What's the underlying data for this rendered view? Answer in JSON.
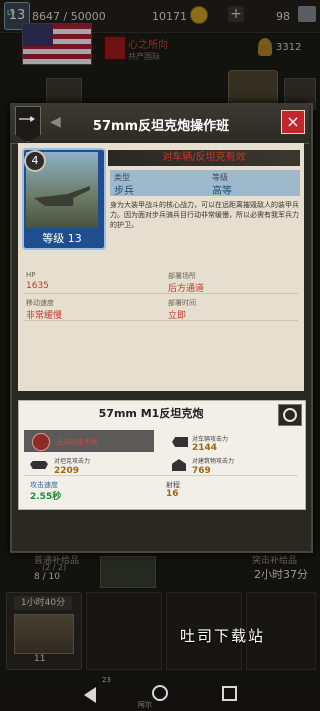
{
  "topbar": {
    "level": "13",
    "level_tag": "Lv",
    "xp": "8647 / 50000",
    "coins": "10171",
    "gold": "98",
    "plus": "+"
  },
  "faction": {
    "name": "心之所向",
    "sub": "共产国际",
    "medal": "3312"
  },
  "modal": {
    "title": "57mm反坦克炮操作班",
    "close": "×",
    "card": {
      "rank": "4",
      "level_label": "等级 13"
    },
    "specialty": "对车辆/反坦克有效",
    "type_label": "类型",
    "type_value": "步兵",
    "grade_label": "等级",
    "grade_value": "高等",
    "description": "身为大装甲战斗的核心战力，可以在远距离摧毁敌人的装甲兵力。因为面对步兵骑兵目行动非常缓慢，所以必需有我军兵力的护卫。",
    "stats": {
      "hp_label": "HP",
      "hp_value": "1635",
      "deploy_place_label": "部署场所",
      "deploy_place_value": "后方通道",
      "move_label": "移动速度",
      "move_value": "非常缓慢",
      "deploy_time_label": "部署时间",
      "deploy_time_value": "立即"
    },
    "weapon": {
      "title": "57mm M1反坦克炮",
      "ability": "无法攻击步兵",
      "anti_vehicle_label": "对车辆攻击力",
      "anti_vehicle_value": "2144",
      "anti_tank_label": "对坦克攻击力",
      "anti_tank_value": "2209",
      "anti_building_label": "对建筑物攻击力",
      "anti_building_value": "769",
      "speed_label": "攻击速度",
      "speed_value": "2.55秒",
      "range_label": "射程",
      "range_value": "16"
    }
  },
  "background": {
    "left_label": "普通补给品",
    "left_count": "(2 / 2)",
    "left_queue": "8 / 10",
    "right_label": "突击补给品",
    "right_time": "2小时37分",
    "crate_time": "1小时40分",
    "crate_count": "11"
  },
  "watermark": "吐司下载站",
  "navbar": {
    "badge": "23",
    "caption": "阿尔"
  }
}
